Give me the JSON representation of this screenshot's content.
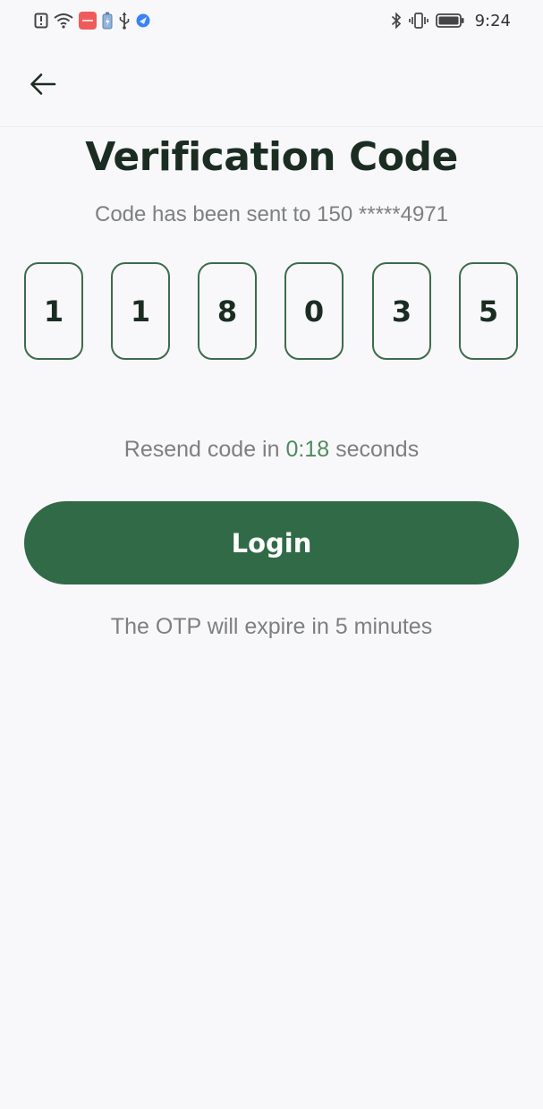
{
  "status_bar": {
    "time": "9:24",
    "icons_left": [
      "alert-icon",
      "wifi-icon",
      "app-notification-icon",
      "battery-saver-icon",
      "usb-icon",
      "browser-icon"
    ],
    "icons_right": [
      "bluetooth-icon",
      "vibrate-icon",
      "battery-icon"
    ]
  },
  "header": {
    "back_icon": "arrow-left-icon"
  },
  "main": {
    "title": "Verification Code",
    "subtitle": "Code has been sent to 150 *****4971",
    "otp_digits": [
      "1",
      "1",
      "8",
      "0",
      "3",
      "5"
    ],
    "resend_prefix": "Resend code in ",
    "resend_timer": "0:18",
    "resend_suffix": " seconds",
    "login_label": "Login",
    "expire_note": "The OTP will expire in 5 minutes"
  },
  "colors": {
    "accent": "#306a47",
    "otp_border": "#3d6b4c",
    "timer": "#4e8a5f",
    "muted_text": "#7d807f",
    "title_text": "#1b2d22",
    "background": "#f8f8fa"
  }
}
